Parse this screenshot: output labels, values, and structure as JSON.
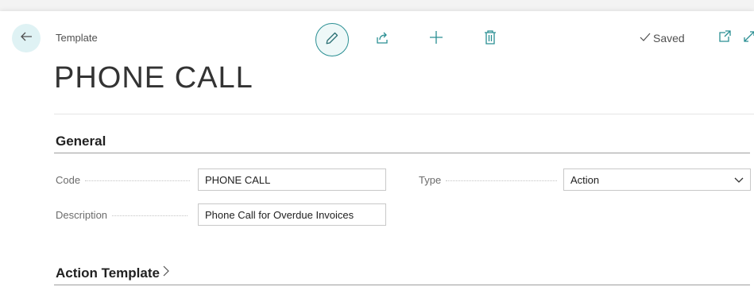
{
  "header": {
    "caption": "Template",
    "title": "PHONE CALL",
    "saved_label": "Saved"
  },
  "general": {
    "section_title": "General",
    "code_label": "Code",
    "code_value": "PHONE CALL",
    "type_label": "Type",
    "type_value": "Action",
    "description_label": "Description",
    "description_value": "Phone Call for Overdue Invoices"
  },
  "action_template": {
    "section_title": "Action Template"
  },
  "colors": {
    "accent": "#2a8f93",
    "back_button_bg": "#dff2f4"
  },
  "icons": {
    "back": "arrow-left-icon",
    "edit": "pencil-icon",
    "share": "share-icon",
    "new": "plus-icon",
    "delete": "trash-icon",
    "saved": "checkmark-icon",
    "open_new_window": "open-in-new-window-icon",
    "expand": "expand-icon",
    "section_expand": "chevron-right-icon",
    "select": "chevron-down-icon"
  }
}
